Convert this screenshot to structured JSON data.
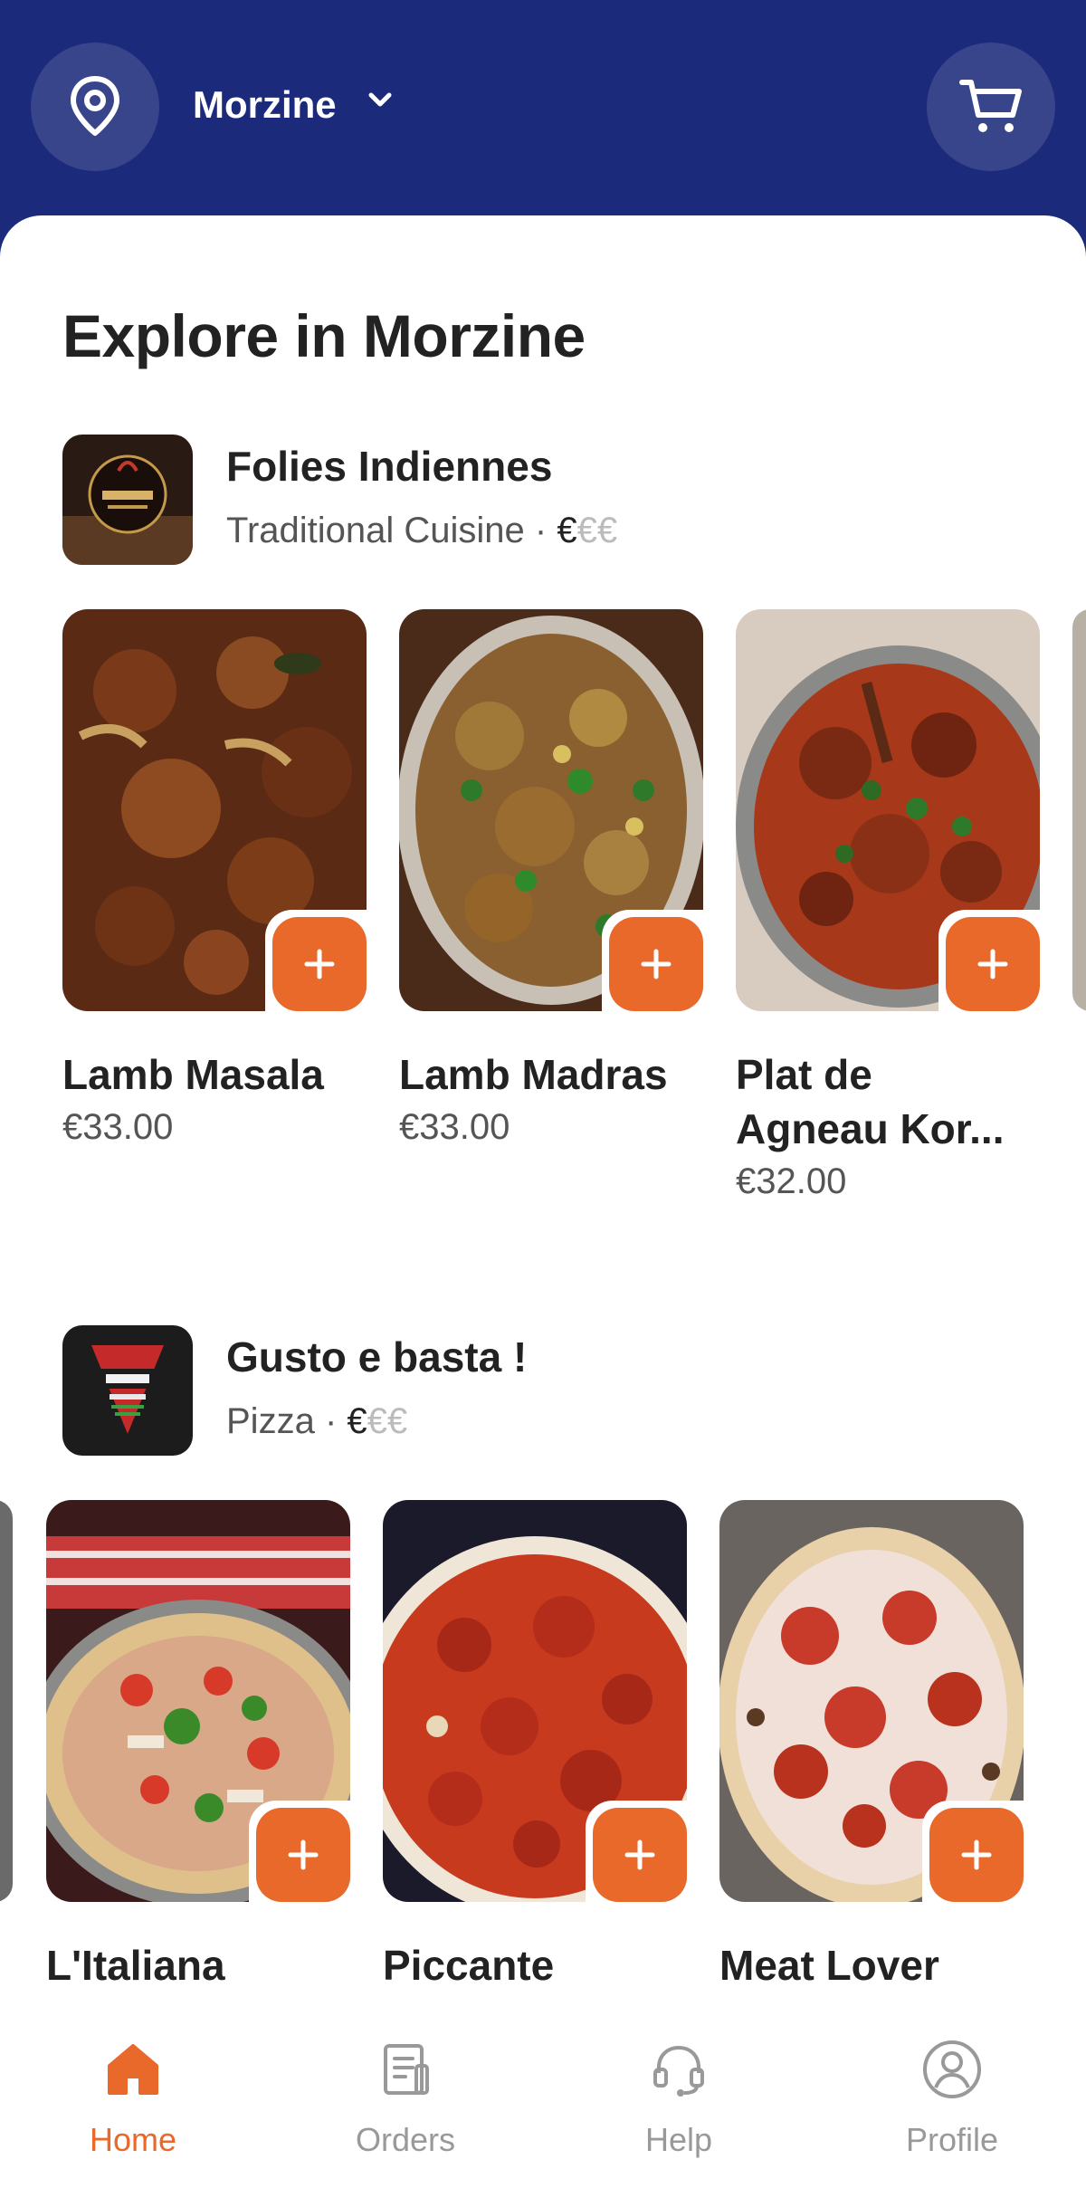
{
  "colors": {
    "brand": "#1b2a7a",
    "accent": "#e8692a"
  },
  "header": {
    "location": "Morzine",
    "location_icon": "map-pin-icon",
    "cart_icon": "cart-icon"
  },
  "main": {
    "title": "Explore in Morzine",
    "restaurants": [
      {
        "name": "Folies Indiennes",
        "category": "Traditional Cuisine",
        "separator": "·",
        "price_on": "€",
        "price_off": "€€",
        "items": [
          {
            "name": "Lamb Masala",
            "price": "€33.00"
          },
          {
            "name": "Lamb Madras",
            "price": "€33.00"
          },
          {
            "name": "Plat de Agneau Kor...",
            "price": "€32.00"
          }
        ]
      },
      {
        "name": "Gusto e basta !",
        "category": "Pizza",
        "separator": "·",
        "price_on": "€",
        "price_off": "€€",
        "items": [
          {
            "name": "L'Italiana",
            "price": ""
          },
          {
            "name": "Piccante",
            "price": ""
          },
          {
            "name": "Meat Lover",
            "price": ""
          }
        ]
      }
    ]
  },
  "tabbar": {
    "tabs": [
      {
        "label": "Home",
        "icon": "home-icon",
        "active": true
      },
      {
        "label": "Orders",
        "icon": "orders-icon",
        "active": false
      },
      {
        "label": "Help",
        "icon": "headset-icon",
        "active": false
      },
      {
        "label": "Profile",
        "icon": "profile-icon",
        "active": false
      }
    ]
  }
}
